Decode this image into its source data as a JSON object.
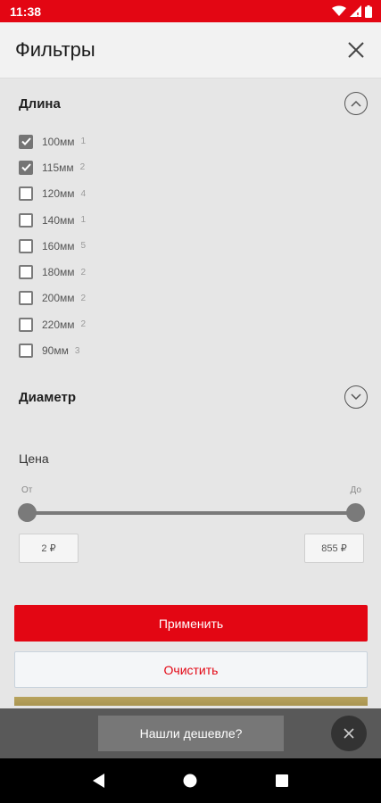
{
  "status_bar": {
    "time": "11:38"
  },
  "header": {
    "title": "Фильтры"
  },
  "length_section": {
    "title": "Длина",
    "options": [
      {
        "label": "100мм",
        "count": "1",
        "checked": true
      },
      {
        "label": "115мм",
        "count": "2",
        "checked": true
      },
      {
        "label": "120мм",
        "count": "4",
        "checked": false
      },
      {
        "label": "140мм",
        "count": "1",
        "checked": false
      },
      {
        "label": "160мм",
        "count": "5",
        "checked": false
      },
      {
        "label": "180мм",
        "count": "2",
        "checked": false
      },
      {
        "label": "200мм",
        "count": "2",
        "checked": false
      },
      {
        "label": "220мм",
        "count": "2",
        "checked": false
      },
      {
        "label": "90мм",
        "count": "3",
        "checked": false
      }
    ]
  },
  "diameter_section": {
    "title": "Диаметр"
  },
  "price_section": {
    "title": "Цена",
    "from_label": "От",
    "to_label": "До",
    "min_value": "2 ₽",
    "max_value": "855 ₽",
    "slider_min_fraction": 0,
    "slider_max_fraction": 1
  },
  "actions": {
    "apply": "Применить",
    "clear": "Очистить"
  },
  "banner": {
    "cheaper": "Нашли дешевле?"
  },
  "colors": {
    "accent": "#e30613",
    "status_bar": "#e30613",
    "background": "#e6e6e6"
  }
}
